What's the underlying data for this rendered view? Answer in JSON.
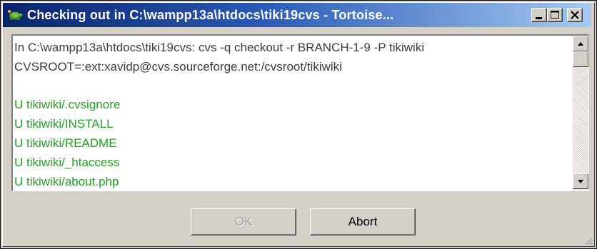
{
  "window": {
    "title": "Checking out in C:\\wampp13a\\htdocs\\tiki19cvs - Tortoise...",
    "icon": "tortoise-cvs-icon"
  },
  "titlebar_buttons": {
    "minimize_icon": "minimize-icon",
    "maximize_icon": "maximize-icon",
    "close_icon": "close-icon"
  },
  "log": {
    "lines": [
      {
        "type": "cmd",
        "text": "In C:\\wampp13a\\htdocs\\tiki19cvs: cvs -q checkout -r BRANCH-1-9 -P tikiwiki"
      },
      {
        "type": "cmd",
        "text": "CVSROOT=:ext:xavidp@cvs.sourceforge.net:/cvsroot/tikiwiki"
      },
      {
        "type": "blank",
        "text": ""
      },
      {
        "type": "ok",
        "text": "U tikiwiki/.cvsignore"
      },
      {
        "type": "ok",
        "text": "U tikiwiki/INSTALL"
      },
      {
        "type": "ok",
        "text": "U tikiwiki/README"
      },
      {
        "type": "ok",
        "text": "U tikiwiki/_htaccess"
      },
      {
        "type": "ok",
        "text": "U tikiwiki/about.php"
      }
    ],
    "colors": {
      "cmd": "#3c3c3c",
      "ok": "#22a022"
    }
  },
  "buttons": {
    "ok_label": "OK",
    "abort_label": "Abort"
  }
}
